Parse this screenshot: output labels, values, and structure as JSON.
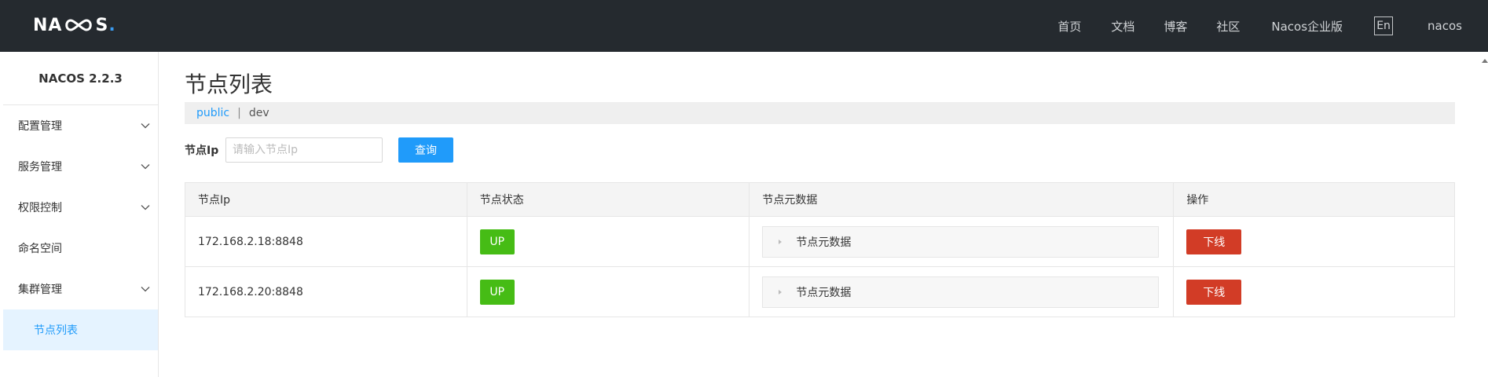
{
  "header": {
    "logo_text_left": "NA",
    "logo_text_right": "S",
    "logo_dot": ".",
    "nav": [
      {
        "label": "首页"
      },
      {
        "label": "文档"
      },
      {
        "label": "博客"
      },
      {
        "label": "社区"
      },
      {
        "label": "Nacos企业版"
      },
      {
        "label": "En"
      },
      {
        "label": "nacos"
      }
    ]
  },
  "sidebar": {
    "version": "NACOS 2.2.3",
    "items": [
      {
        "label": "配置管理",
        "expandable": true
      },
      {
        "label": "服务管理",
        "expandable": true
      },
      {
        "label": "权限控制",
        "expandable": true
      },
      {
        "label": "命名空间",
        "expandable": false
      },
      {
        "label": "集群管理",
        "expandable": true
      },
      {
        "label": "节点列表",
        "active": true
      }
    ]
  },
  "main": {
    "title": "节点列表",
    "namespaces": {
      "items": [
        "public",
        "dev"
      ],
      "separator": "|"
    },
    "search": {
      "label": "节点Ip",
      "placeholder": "请输入节点Ip",
      "value": "",
      "button": "查询"
    },
    "table": {
      "columns": [
        "节点Ip",
        "节点状态",
        "节点元数据",
        "操作"
      ],
      "rows": [
        {
          "ip": "172.168.2.18:8848",
          "status": "UP",
          "metadata": "节点元数据",
          "action": "下线"
        },
        {
          "ip": "172.168.2.20:8848",
          "status": "UP",
          "metadata": "节点元数据",
          "action": "下线"
        }
      ]
    }
  },
  "colors": {
    "topbar": "#252a2f",
    "accent": "#209bfa",
    "status_up": "#46bc15",
    "danger": "#d23c26"
  }
}
